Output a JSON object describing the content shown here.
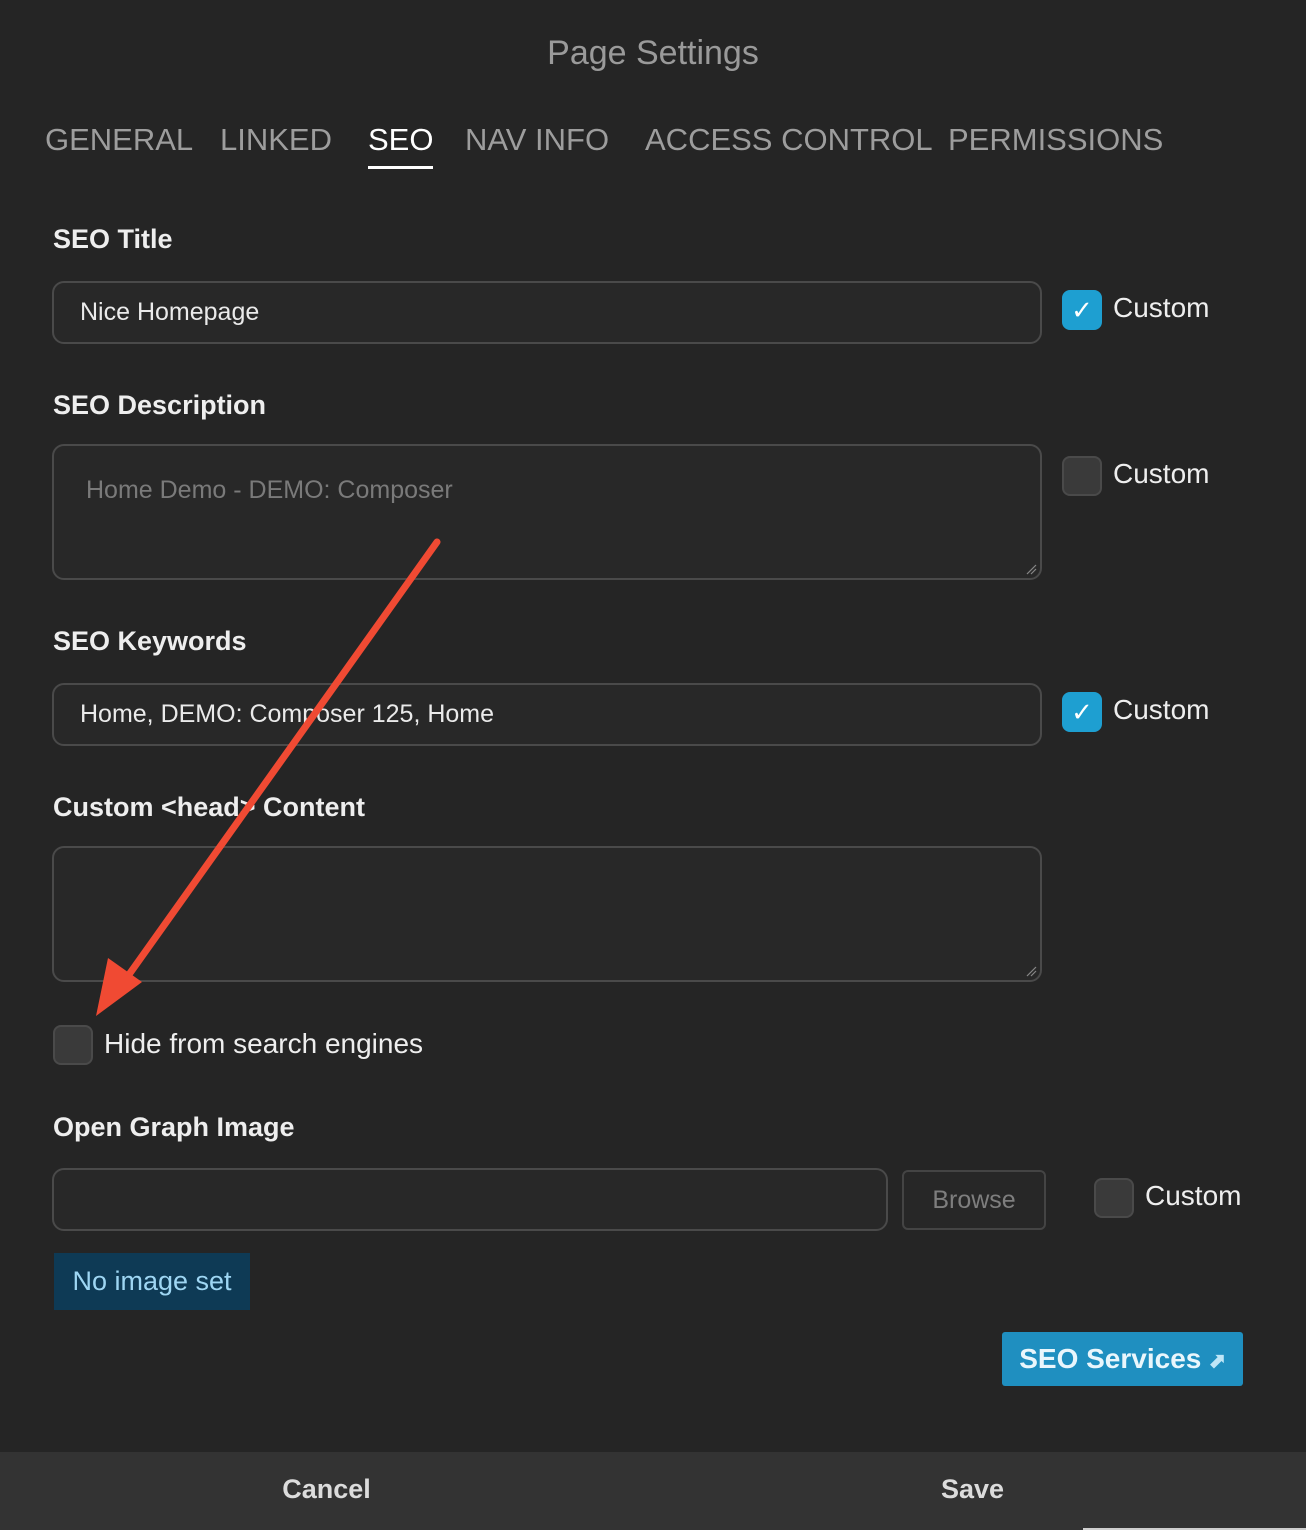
{
  "dialog": {
    "title": "Page Settings"
  },
  "tabs": [
    {
      "label": "GENERAL",
      "active": false
    },
    {
      "label": "LINKED",
      "active": false
    },
    {
      "label": "SEO",
      "active": true
    },
    {
      "label": "NAV INFO",
      "active": false
    },
    {
      "label": "ACCESS CONTROL",
      "active": false
    },
    {
      "label": "PERMISSIONS",
      "active": false
    }
  ],
  "seo_title": {
    "label": "SEO Title",
    "value": "Nice Homepage",
    "custom_label": "Custom",
    "custom_checked": true
  },
  "seo_description": {
    "label": "SEO Description",
    "value": "",
    "placeholder": "Home Demo - DEMO: Composer",
    "custom_label": "Custom",
    "custom_checked": false
  },
  "seo_keywords": {
    "label": "SEO Keywords",
    "value": "Home, DEMO: Composer 125, Home",
    "custom_label": "Custom",
    "custom_checked": true
  },
  "custom_head": {
    "label": "Custom <head> Content",
    "value": ""
  },
  "hide_search": {
    "label": "Hide from search engines",
    "checked": false
  },
  "open_graph": {
    "label": "Open Graph Image",
    "value": "",
    "browse_label": "Browse",
    "custom_label": "Custom",
    "custom_checked": false,
    "status": "No image set"
  },
  "seo_services": {
    "label": "SEO Services",
    "icon": "external-link-icon"
  },
  "footer": {
    "cancel_label": "Cancel",
    "save_label": "Save"
  },
  "colors": {
    "accent": "#1e9fd1",
    "annotation_arrow": "#f04a33",
    "background": "#252525"
  }
}
